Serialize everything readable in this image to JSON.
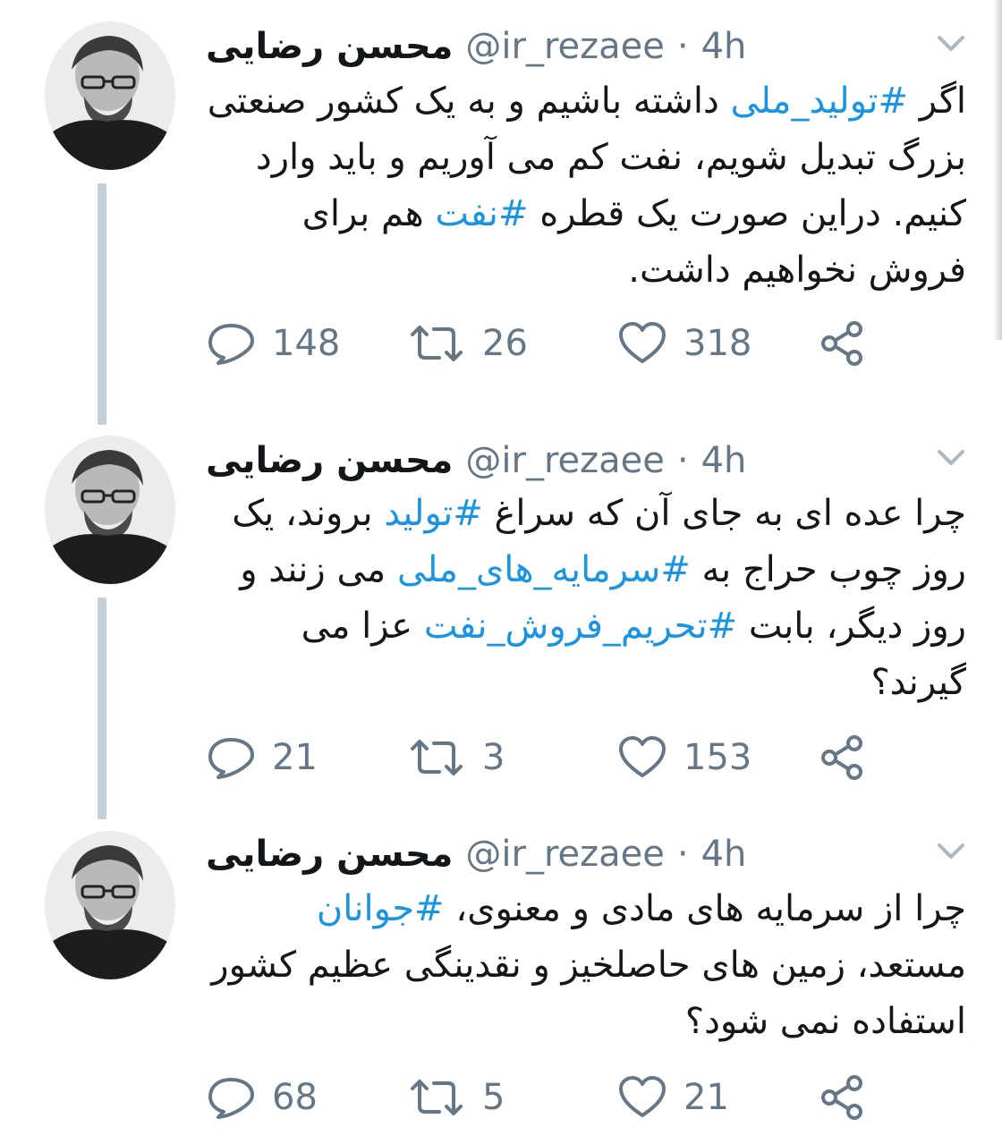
{
  "tweets": [
    {
      "author": {
        "name": "محسن رضایی",
        "handle": "@ir_rezaee",
        "separator": "·",
        "time": "4h"
      },
      "text_segments": [
        {
          "text": "اگر ",
          "type": "text"
        },
        {
          "text": "#تولید_ملی",
          "type": "hashtag"
        },
        {
          "text": " داشته باشیم و به یک کشور صنعتی بزرگ تبدیل شویم، نفت کم می آوریم و باید وارد کنیم. دراین صورت یک قطره ",
          "type": "text"
        },
        {
          "text": "#نفت",
          "type": "hashtag"
        },
        {
          "text": " هم برای فروش نخواهیم داشت.",
          "type": "text"
        }
      ],
      "counts": {
        "replies": "148",
        "retweets": "26",
        "likes": "318"
      }
    },
    {
      "author": {
        "name": "محسن رضایی",
        "handle": "@ir_rezaee",
        "separator": "·",
        "time": "4h"
      },
      "text_segments": [
        {
          "text": "چرا عده ای به جای آن که سراغ ",
          "type": "text"
        },
        {
          "text": "#تولید",
          "type": "hashtag"
        },
        {
          "text": " بروند، یک روز چوب حراج به ",
          "type": "text"
        },
        {
          "text": "#سرمایه_های_ملی",
          "type": "hashtag"
        },
        {
          "text": " می زنند و روز دیگر، بابت ",
          "type": "text"
        },
        {
          "text": "#تحریم_فروش_نفت",
          "type": "hashtag"
        },
        {
          "text": " عزا می گیرند؟",
          "type": "text"
        }
      ],
      "counts": {
        "replies": "21",
        "retweets": "3",
        "likes": "153"
      }
    },
    {
      "author": {
        "name": "محسن رضایی",
        "handle": "@ir_rezaee",
        "separator": "·",
        "time": "4h"
      },
      "text_segments": [
        {
          "text": "چرا از سرمایه های مادی و معنوی، ",
          "type": "text"
        },
        {
          "text": "#جوانان",
          "type": "hashtag"
        },
        {
          "text": " مستعد، زمین های حاصلخیز و نقدینگی عظیم کشور استفاده نمی شود؟",
          "type": "text"
        }
      ],
      "counts": {
        "replies": "68",
        "retweets": "5",
        "likes": "21"
      }
    }
  ],
  "icons": {
    "reply": "speech-bubble-icon",
    "retweet": "retweet-arrows-icon",
    "like": "heart-icon",
    "share": "share-nodes-icon",
    "menu": "chevron-down-icon"
  },
  "colors": {
    "hashtag": "#1b95e0",
    "secondary": "#657786",
    "thread_line": "#c4cfd6",
    "text": "#14171a"
  }
}
